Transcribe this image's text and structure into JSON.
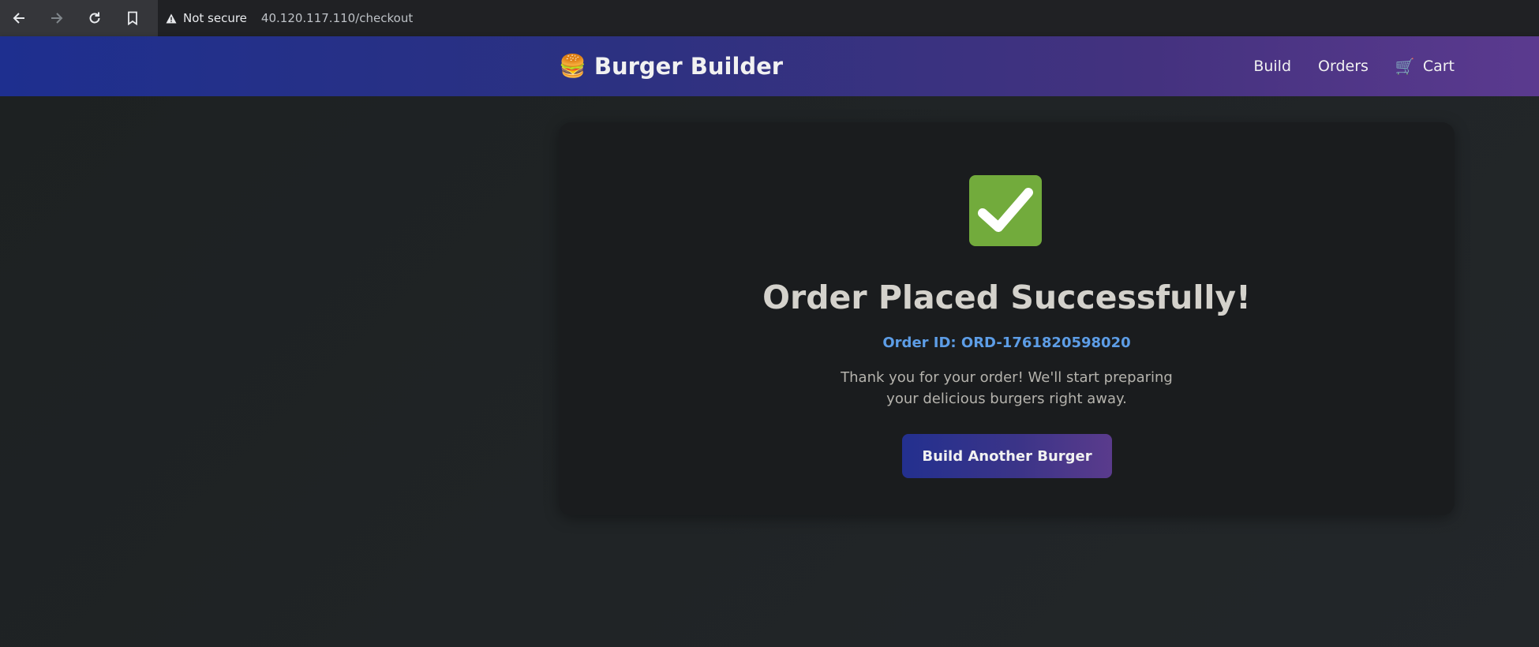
{
  "browser": {
    "security_label": "Not secure",
    "url": "40.120.117.110/checkout"
  },
  "navbar": {
    "brand_icon": "🍔",
    "brand": "Burger Builder",
    "links": {
      "build": "Build",
      "orders": "Orders",
      "cart_icon": "🛒",
      "cart": "Cart"
    }
  },
  "confirmation": {
    "icon": "check-mark-icon",
    "title": "Order Placed Successfully!",
    "order_id": "Order ID: ORD-1761820598020",
    "message": "Thank you for your order! We'll start preparing your delicious burgers right away.",
    "button": "Build Another Burger"
  },
  "colors": {
    "accent_link": "#5d9de6",
    "check_bg": "#72ab3c",
    "nav_gradient_start": "#1e2f8f",
    "nav_gradient_end": "#5b3a8f"
  }
}
